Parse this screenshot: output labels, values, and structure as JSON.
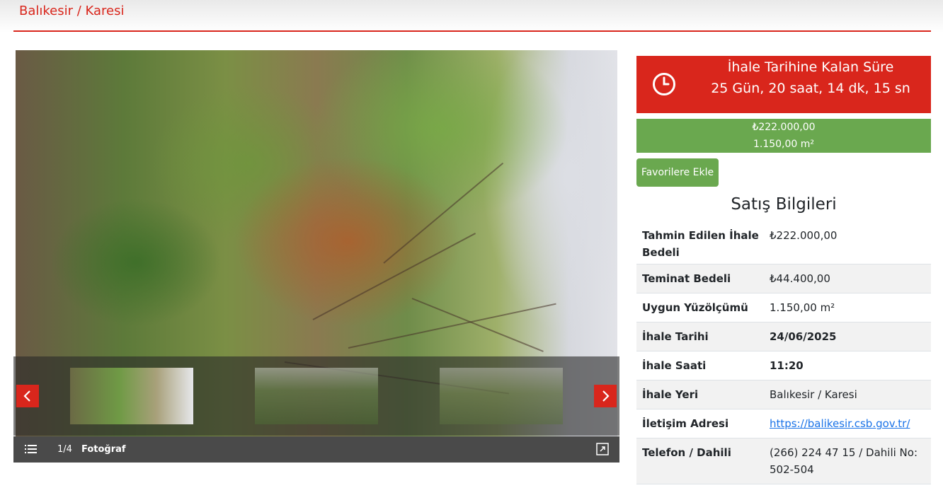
{
  "header": {
    "breadcrumb": "Balıkesir / Karesi"
  },
  "gallery": {
    "counter": "1/4",
    "caption": "Fotoğraf",
    "prev_symbol": "‹",
    "next_symbol": "›"
  },
  "countdown": {
    "title": "İhale Tarihine Kalan Süre",
    "time": "25 Gün, 20 saat, 14 dk, 15 sn"
  },
  "price": {
    "amount": "₺222.000,00",
    "area": "1.150,00 m²"
  },
  "actions": {
    "favorite_label": "Favorilere Ekle"
  },
  "sale_info": {
    "title": "Satış Bilgileri",
    "rows": [
      {
        "key": "Tahmin Edilen İhale Bedeli",
        "value": "₺222.000,00"
      },
      {
        "key": "Teminat Bedeli",
        "value": "₺44.400,00"
      },
      {
        "key": "Uygun Yüzölçümü",
        "value": "1.150,00 m²"
      },
      {
        "key": "İhale Tarihi",
        "value": "24/06/2025"
      },
      {
        "key": "İhale Saati",
        "value": "11:20"
      },
      {
        "key": "İhale Yeri",
        "value": "Balıkesir / Karesi"
      },
      {
        "key": "İletişim Adresi",
        "value": "https://balikesir.csb.gov.tr/"
      },
      {
        "key": "Telefon / Dahili",
        "value": "(266) 224 47 15 / Dahili No: 502-504"
      }
    ]
  },
  "colors": {
    "brand_red": "#d9261c",
    "green": "#6aa84f",
    "link": "#1a73e8"
  }
}
